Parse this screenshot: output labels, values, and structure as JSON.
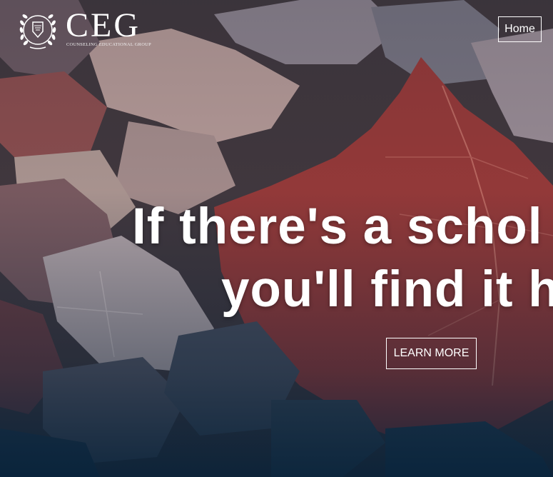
{
  "brand": {
    "wordmark": "CEG",
    "tagline": "COUNSELING EDUCATIONAL GROUP",
    "emblem_icon": "laurel-shield-icon"
  },
  "nav": {
    "home_label": "Home"
  },
  "hero": {
    "headline_line1": "If there's a schol",
    "headline_line2": "you'll find it h",
    "cta_label": "LEARN MORE",
    "background_image": "autumn-maple-leaves"
  },
  "colors": {
    "text": "#ffffff",
    "leaf_red": "#9e3a37",
    "leaf_pale": "#b79a96",
    "bottom_tint": "#0f2a3c"
  }
}
